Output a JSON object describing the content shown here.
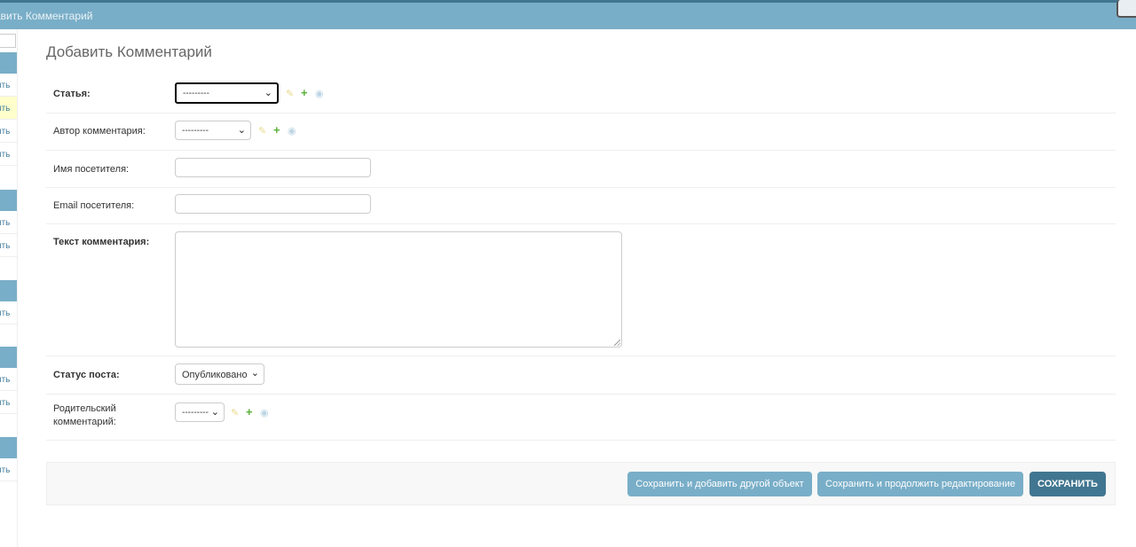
{
  "header": {
    "breadcrumb": "авить Комментарий"
  },
  "sidebar": {
    "rows": [
      {
        "label": "ить"
      },
      {
        "label": "ить"
      },
      {
        "label": "ить"
      },
      {
        "label": "ить"
      },
      {
        "label": "ить"
      },
      {
        "label": "ить"
      },
      {
        "label": "ить"
      },
      {
        "label": "ить"
      },
      {
        "label": "ить"
      },
      {
        "label": "ить"
      }
    ]
  },
  "page": {
    "title": "Добавить Комментарий"
  },
  "form": {
    "article": {
      "label": "Статья:",
      "value": "---------"
    },
    "author": {
      "label": "Автор комментария:",
      "value": "---------"
    },
    "visitor_name": {
      "label": "Имя посетителя:",
      "value": ""
    },
    "visitor_email": {
      "label": "Email посетителя:",
      "value": ""
    },
    "comment_text": {
      "label": "Текст комментария:",
      "value": ""
    },
    "status": {
      "label": "Статус поста:",
      "value": "Опубликовано"
    },
    "parent": {
      "label": "Родительский комментарий:",
      "value": "---------"
    }
  },
  "icons": {
    "edit": "pencil-icon",
    "add": "plus-icon",
    "view": "eye-icon"
  },
  "actions": {
    "save_add_another": "Сохранить и добавить другой объект",
    "save_continue": "Сохранить и продолжить редактирование",
    "save": "СОХРАНИТЬ"
  },
  "colors": {
    "header": "#79aec8",
    "primary_button": "#417690",
    "secondary_button": "#79aec8",
    "accent": "#5ab13b"
  }
}
